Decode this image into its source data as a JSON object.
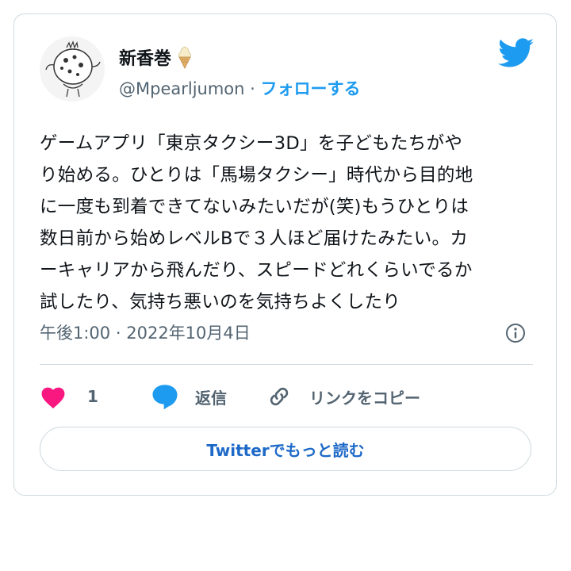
{
  "author": {
    "name": "新香巻",
    "name_emoji_icon": "soft-serve-icon",
    "handle": "@Mpearljumon",
    "separator": "·",
    "follow_label": "フォローする"
  },
  "tweet": {
    "lines": [
      "ゲームアプリ「東京タクシー3D」を子どもたちがや",
      "り始める。ひとりは「馬場タクシー」時代から目的地",
      "に一度も到着できてないみたいだが(笑)もうひとりは",
      "数日前から始めレベルBで３人ほど届けたみたい。カ",
      "ーキャリアから飛んだり、スピードどれくらいでるか",
      "試したり、気持ち悪いのを気持ちよくしたり"
    ]
  },
  "meta": {
    "time": "午後1:00",
    "separator": "·",
    "date": "2022年10月4日",
    "info_icon": "info-icon"
  },
  "actions": {
    "like_count": "1",
    "reply_label": "返信",
    "copy_link_label": "リンクをコピー"
  },
  "read_more_label": "Twitterでもっと読む",
  "colors": {
    "twitter_blue": "#1d9bf0",
    "heart_pink": "#f91880",
    "text_primary": "#0f1419",
    "text_secondary": "#536471",
    "border": "#cfd9de"
  }
}
